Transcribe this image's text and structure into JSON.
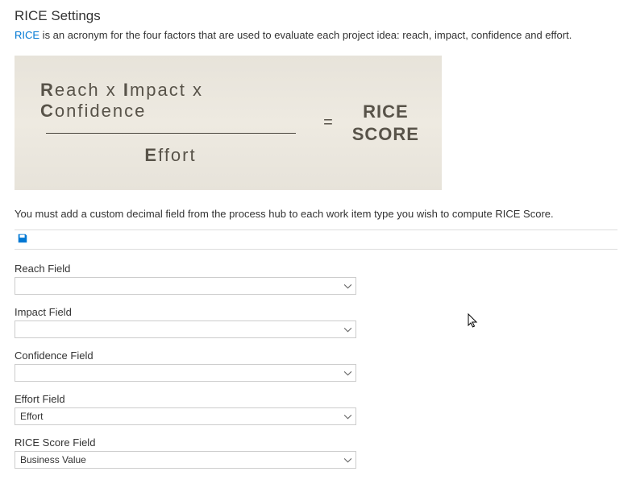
{
  "title": "RICE Settings",
  "intro": {
    "acronym": "RICE",
    "rest": " is an acronym for the four factors that are used to evaluate each project idea: reach, impact, confidence and effort."
  },
  "formula": {
    "reach": "Reach",
    "x1": " x ",
    "impact": "Impact",
    "x2": " x ",
    "confidence": "Confidence",
    "effort": "Effort",
    "equals": "=",
    "riceLabel": "RICE",
    "scoreLabel": "SCORE"
  },
  "instructions": "You must add a custom decimal field from the process hub to each work item type you wish to compute RICE Score.",
  "fields": {
    "reach": {
      "label": "Reach Field",
      "value": ""
    },
    "impact": {
      "label": "Impact Field",
      "value": ""
    },
    "confidence": {
      "label": "Confidence Field",
      "value": ""
    },
    "effort": {
      "label": "Effort Field",
      "value": "Effort"
    },
    "score": {
      "label": "RICE Score Field",
      "value": "Business Value"
    }
  }
}
